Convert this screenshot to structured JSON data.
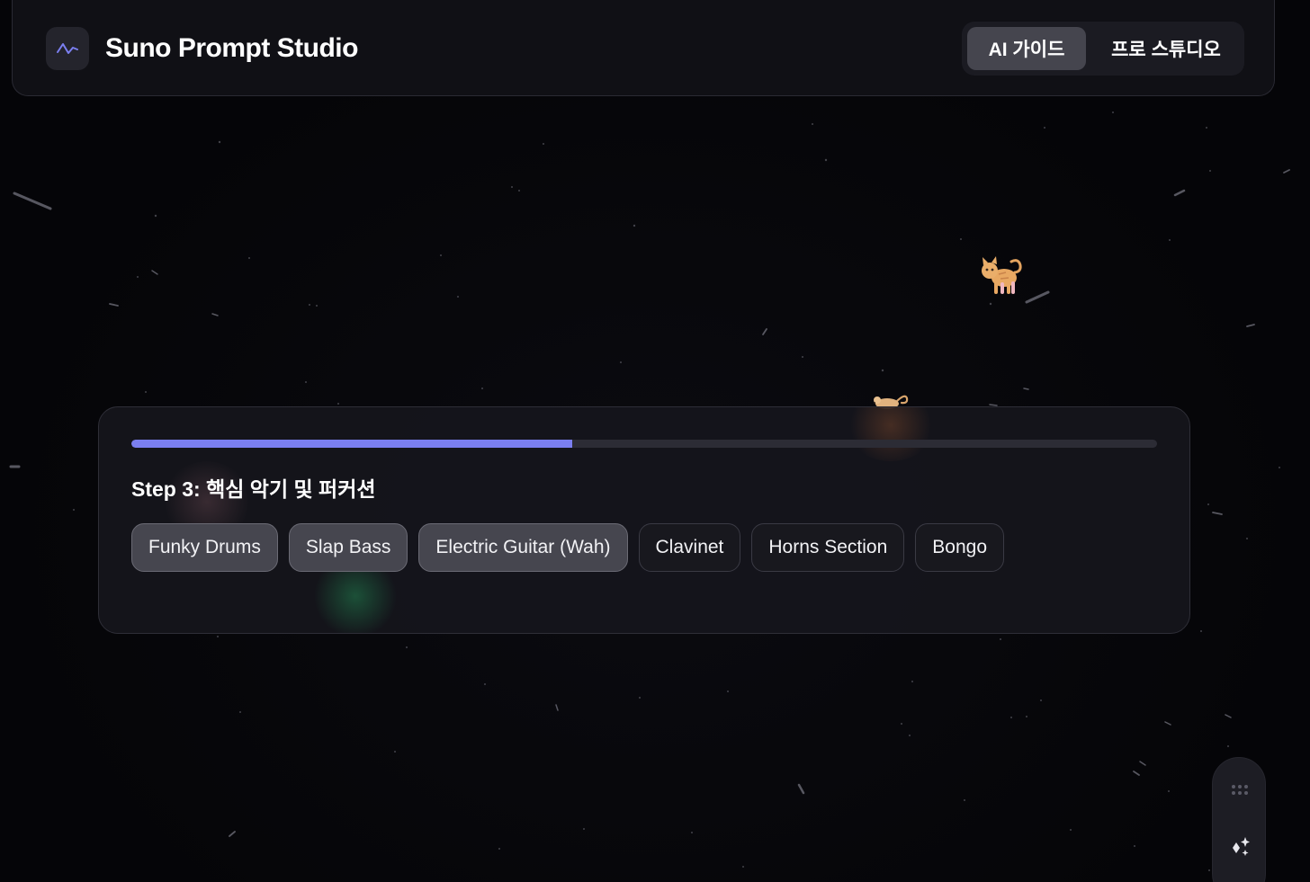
{
  "header": {
    "logo_icon": "waveform-icon",
    "title": "Suno Prompt Studio",
    "modes": [
      {
        "label": "AI 가이드",
        "active": true
      },
      {
        "label": "프로 스튜디오",
        "active": false
      }
    ]
  },
  "decor": {
    "cat_icon": "cat-icon",
    "mouse_icon": "mouse-icon"
  },
  "wizard": {
    "progress_percent": 43,
    "step_title": "Step 3: 핵심 악기 및 퍼커션",
    "chips": [
      {
        "label": "Funky Drums",
        "selected": true
      },
      {
        "label": "Slap Bass",
        "selected": true
      },
      {
        "label": "Electric Guitar (Wah)",
        "selected": true
      },
      {
        "label": "Clavinet",
        "selected": false
      },
      {
        "label": "Horns Section",
        "selected": false
      },
      {
        "label": "Bongo",
        "selected": false
      }
    ]
  },
  "side_widget": {
    "grip_icon": "drag-grip-icon",
    "action_icon": "sparkle-icon"
  },
  "colors": {
    "accent": "#7b7ff0",
    "background": "#050508",
    "card": "#16161c",
    "chip_selected": "#46464f"
  }
}
